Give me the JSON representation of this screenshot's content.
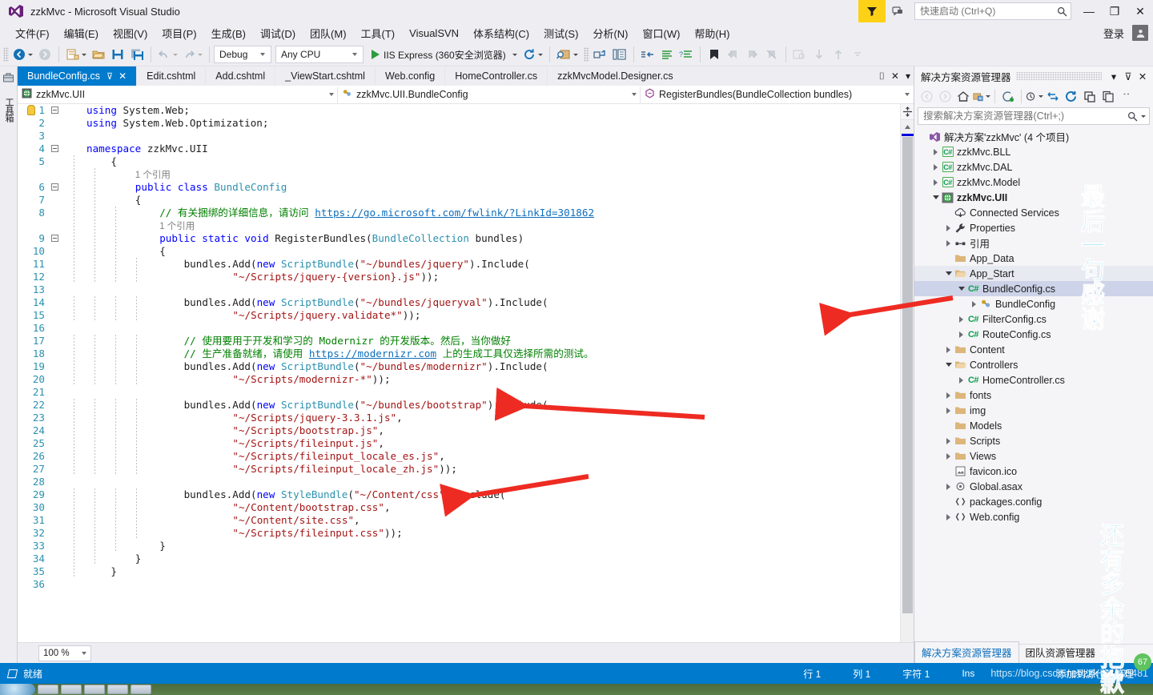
{
  "window": {
    "title": "zzkMvc - Microsoft Visual Studio",
    "minimize": "—",
    "maximize": "❐",
    "close": "✕",
    "signin": "登录",
    "accent": "#007acc"
  },
  "quick_launch": {
    "placeholder": "快速启动 (Ctrl+Q)",
    "value": ""
  },
  "menu": [
    {
      "label": "文件(F)"
    },
    {
      "label": "编辑(E)"
    },
    {
      "label": "视图(V)"
    },
    {
      "label": "项目(P)"
    },
    {
      "label": "生成(B)"
    },
    {
      "label": "调试(D)"
    },
    {
      "label": "团队(M)"
    },
    {
      "label": "工具(T)"
    },
    {
      "label": "VisualSVN"
    },
    {
      "label": "体系结构(C)"
    },
    {
      "label": "测试(S)"
    },
    {
      "label": "分析(N)"
    },
    {
      "label": "窗口(W)"
    },
    {
      "label": "帮助(H)"
    }
  ],
  "toolbar": {
    "configuration": "Debug",
    "platform": "Any CPU",
    "run_target": "IIS Express (360安全浏览器)",
    "icons": [
      "navigate-back-icon",
      "navigate-forward-icon",
      "new-project-icon",
      "open-file-icon",
      "save-icon",
      "save-all-icon",
      "undo-icon",
      "redo-icon",
      "refresh-icon",
      "find-icon",
      "goto-icon",
      "comment-icon",
      "uncomment-icon",
      "indent-icon",
      "outdent-icon",
      "bookmark-icon",
      "prev-bookmark-icon",
      "next-bookmark-icon",
      "clear-bookmarks-icon",
      "preview-icon",
      "step-down-icon",
      "step-up-icon"
    ]
  },
  "left_dock": {
    "toolbox_label": "工具箱"
  },
  "document_tabs": [
    {
      "label": "BundleConfig.cs",
      "active": true,
      "pin": "⊽",
      "close": "✕"
    },
    {
      "label": "Edit.cshtml",
      "active": false
    },
    {
      "label": "Add.cshtml",
      "active": false
    },
    {
      "label": "_ViewStart.cshtml",
      "active": false
    },
    {
      "label": "Web.config",
      "active": false
    },
    {
      "label": "HomeController.cs",
      "active": false
    },
    {
      "label": "zzkMvcModel.Designer.cs",
      "active": false
    }
  ],
  "tabstrip_right": {
    "pin": "⌷",
    "close": "✕",
    "overflow": "▾"
  },
  "navigation_bar": {
    "project": "zzkMvc.UII",
    "type": "zzkMvc.UII.BundleConfig",
    "member": "RegisterBundles(BundleCollection bundles)"
  },
  "code": {
    "total_lines": 36,
    "reference_badge": "1 个引用",
    "lines": [
      {
        "n": 1,
        "segments": [
          {
            "t": "k",
            "v": "using"
          },
          {
            "t": "pl",
            "v": " System.Web;"
          }
        ],
        "indent": 0,
        "fold": "minus",
        "bulb": true
      },
      {
        "n": 2,
        "segments": [
          {
            "t": "k",
            "v": "using"
          },
          {
            "t": "pl",
            "v": " System.Web.Optimization;"
          }
        ],
        "indent": 0
      },
      {
        "n": 3,
        "segments": []
      },
      {
        "n": 4,
        "segments": [
          {
            "t": "k",
            "v": "namespace"
          },
          {
            "t": "pl",
            "v": " zzkMvc.UII"
          }
        ],
        "indent": 0,
        "fold": "minus"
      },
      {
        "n": 5,
        "segments": [
          {
            "t": "pl",
            "v": "{"
          }
        ],
        "indent": 1
      },
      {
        "n": null,
        "segments": [
          {
            "t": "ref",
            "v": "1 个引用"
          }
        ],
        "indent": 2
      },
      {
        "n": 6,
        "segments": [
          {
            "t": "k",
            "v": "public"
          },
          {
            "t": "pl",
            "v": " "
          },
          {
            "t": "k",
            "v": "class"
          },
          {
            "t": "pl",
            "v": " "
          },
          {
            "t": "t",
            "v": "BundleConfig"
          }
        ],
        "indent": 2,
        "fold": "minus"
      },
      {
        "n": 7,
        "segments": [
          {
            "t": "pl",
            "v": "{"
          }
        ],
        "indent": 2
      },
      {
        "n": 8,
        "segments": [
          {
            "t": "c",
            "v": "// 有关捆绑的详细信息，请访问 "
          },
          {
            "t": "lnk",
            "v": "https://go.microsoft.com/fwlink/?LinkId=301862"
          }
        ],
        "indent": 3
      },
      {
        "n": null,
        "segments": [
          {
            "t": "ref",
            "v": "1 个引用"
          }
        ],
        "indent": 3
      },
      {
        "n": 9,
        "segments": [
          {
            "t": "k",
            "v": "public"
          },
          {
            "t": "pl",
            "v": " "
          },
          {
            "t": "k",
            "v": "static"
          },
          {
            "t": "pl",
            "v": " "
          },
          {
            "t": "k",
            "v": "void"
          },
          {
            "t": "pl",
            "v": " RegisterBundles("
          },
          {
            "t": "t",
            "v": "BundleCollection"
          },
          {
            "t": "pl",
            "v": " bundles)"
          }
        ],
        "indent": 3,
        "fold": "minus"
      },
      {
        "n": 10,
        "segments": [
          {
            "t": "pl",
            "v": "{"
          }
        ],
        "indent": 3
      },
      {
        "n": 11,
        "segments": [
          {
            "t": "pl",
            "v": "bundles.Add("
          },
          {
            "t": "k",
            "v": "new"
          },
          {
            "t": "pl",
            "v": " "
          },
          {
            "t": "t",
            "v": "ScriptBundle"
          },
          {
            "t": "pl",
            "v": "("
          },
          {
            "t": "s",
            "v": "\"~/bundles/jquery\""
          },
          {
            "t": "pl",
            "v": ").Include("
          }
        ],
        "indent": 4
      },
      {
        "n": 12,
        "segments": [
          {
            "t": "s",
            "v": "\"~/Scripts/jquery-{version}.js\""
          },
          {
            "t": "pl",
            "v": "));"
          }
        ],
        "indent": 6
      },
      {
        "n": 13,
        "segments": []
      },
      {
        "n": 14,
        "segments": [
          {
            "t": "pl",
            "v": "bundles.Add("
          },
          {
            "t": "k",
            "v": "new"
          },
          {
            "t": "pl",
            "v": " "
          },
          {
            "t": "t",
            "v": "ScriptBundle"
          },
          {
            "t": "pl",
            "v": "("
          },
          {
            "t": "s",
            "v": "\"~/bundles/jqueryval\""
          },
          {
            "t": "pl",
            "v": ").Include("
          }
        ],
        "indent": 4
      },
      {
        "n": 15,
        "segments": [
          {
            "t": "s",
            "v": "\"~/Scripts/jquery.validate*\""
          },
          {
            "t": "pl",
            "v": "));"
          }
        ],
        "indent": 6
      },
      {
        "n": 16,
        "segments": []
      },
      {
        "n": 17,
        "segments": [
          {
            "t": "c",
            "v": "// 使用要用于开发和学习的 Modernizr 的开发版本。然后，当你做好"
          }
        ],
        "indent": 4
      },
      {
        "n": 18,
        "segments": [
          {
            "t": "c",
            "v": "// 生产准备就绪，请使用 "
          },
          {
            "t": "lnk",
            "v": "https://modernizr.com"
          },
          {
            "t": "c",
            "v": " 上的生成工具仅选择所需的测试。"
          }
        ],
        "indent": 4
      },
      {
        "n": 19,
        "segments": [
          {
            "t": "pl",
            "v": "bundles.Add("
          },
          {
            "t": "k",
            "v": "new"
          },
          {
            "t": "pl",
            "v": " "
          },
          {
            "t": "t",
            "v": "ScriptBundle"
          },
          {
            "t": "pl",
            "v": "("
          },
          {
            "t": "s",
            "v": "\"~/bundles/modernizr\""
          },
          {
            "t": "pl",
            "v": ").Include("
          }
        ],
        "indent": 4
      },
      {
        "n": 20,
        "segments": [
          {
            "t": "s",
            "v": "\"~/Scripts/modernizr-*\""
          },
          {
            "t": "pl",
            "v": "));"
          }
        ],
        "indent": 6
      },
      {
        "n": 21,
        "segments": []
      },
      {
        "n": 22,
        "segments": [
          {
            "t": "pl",
            "v": "bundles.Add("
          },
          {
            "t": "k",
            "v": "new"
          },
          {
            "t": "pl",
            "v": " "
          },
          {
            "t": "t",
            "v": "ScriptBundle"
          },
          {
            "t": "pl",
            "v": "("
          },
          {
            "t": "s",
            "v": "\"~/bundles/bootstrap\""
          },
          {
            "t": "pl",
            "v": ").Include("
          }
        ],
        "indent": 4
      },
      {
        "n": 23,
        "segments": [
          {
            "t": "s",
            "v": "\"~/Scripts/jquery-3.3.1.js\""
          },
          {
            "t": "pl",
            "v": ","
          }
        ],
        "indent": 6
      },
      {
        "n": 24,
        "segments": [
          {
            "t": "s",
            "v": "\"~/Scripts/bootstrap.js\""
          },
          {
            "t": "pl",
            "v": ","
          }
        ],
        "indent": 6
      },
      {
        "n": 25,
        "segments": [
          {
            "t": "s",
            "v": "\"~/Scripts/fileinput.js\""
          },
          {
            "t": "pl",
            "v": ","
          }
        ],
        "indent": 6
      },
      {
        "n": 26,
        "segments": [
          {
            "t": "s",
            "v": "\"~/Scripts/fileinput_locale_es.js\""
          },
          {
            "t": "pl",
            "v": ","
          }
        ],
        "indent": 6
      },
      {
        "n": 27,
        "segments": [
          {
            "t": "s",
            "v": "\"~/Scripts/fileinput_locale_zh.js\""
          },
          {
            "t": "pl",
            "v": "));"
          }
        ],
        "indent": 6
      },
      {
        "n": 28,
        "segments": []
      },
      {
        "n": 29,
        "segments": [
          {
            "t": "pl",
            "v": "bundles.Add("
          },
          {
            "t": "k",
            "v": "new"
          },
          {
            "t": "pl",
            "v": " "
          },
          {
            "t": "t",
            "v": "StyleBundle"
          },
          {
            "t": "pl",
            "v": "("
          },
          {
            "t": "s",
            "v": "\"~/Content/css\""
          },
          {
            "t": "pl",
            "v": ").Include("
          }
        ],
        "indent": 4
      },
      {
        "n": 30,
        "segments": [
          {
            "t": "s",
            "v": "\"~/Content/bootstrap.css\""
          },
          {
            "t": "pl",
            "v": ","
          }
        ],
        "indent": 6
      },
      {
        "n": 31,
        "segments": [
          {
            "t": "s",
            "v": "\"~/Content/site.css\""
          },
          {
            "t": "pl",
            "v": ","
          }
        ],
        "indent": 6
      },
      {
        "n": 32,
        "segments": [
          {
            "t": "s",
            "v": "\"~/Scripts/fileinput.css\""
          },
          {
            "t": "pl",
            "v": "));"
          }
        ],
        "indent": 6
      },
      {
        "n": 33,
        "segments": [
          {
            "t": "pl",
            "v": "}"
          }
        ],
        "indent": 3
      },
      {
        "n": 34,
        "segments": [
          {
            "t": "pl",
            "v": "}"
          }
        ],
        "indent": 2
      },
      {
        "n": 35,
        "segments": [
          {
            "t": "pl",
            "v": "}"
          }
        ],
        "indent": 1
      },
      {
        "n": 36,
        "segments": []
      }
    ]
  },
  "editor_footer": {
    "zoom": "100 %"
  },
  "solution_explorer": {
    "title": "解决方案资源管理器",
    "dropdown": "▾",
    "pin": "⊽",
    "close": "✕",
    "search_placeholder": "搜索解决方案资源管理器(Ctrl+;)",
    "search_value": "",
    "toolbar_icons": [
      "back-icon",
      "forward-icon",
      "home-icon",
      "pending-changes-icon",
      "sync-with-active-document-icon",
      "refresh-icon",
      "show-all-files-icon",
      "collapse-all-icon",
      "properties-icon",
      "preview-icon"
    ],
    "tree": [
      {
        "depth": 0,
        "twisty": "none",
        "icon": "solution-icon",
        "label": "解决方案'zzkMvc' (4 个项目)",
        "bold": false
      },
      {
        "depth": 1,
        "twisty": "right",
        "icon": "csharp-icon",
        "label": "zzkMvc.BLL"
      },
      {
        "depth": 1,
        "twisty": "right",
        "icon": "csharp-icon",
        "label": "zzkMvc.DAL"
      },
      {
        "depth": 1,
        "twisty": "right",
        "icon": "csharp-icon",
        "label": "zzkMvc.Model"
      },
      {
        "depth": 1,
        "twisty": "down",
        "icon": "web-project-icon",
        "label": "zzkMvc.UII",
        "bold": true
      },
      {
        "depth": 2,
        "twisty": "none",
        "icon": "connected-services-icon",
        "label": "Connected Services"
      },
      {
        "depth": 2,
        "twisty": "right",
        "icon": "properties-wrench-icon",
        "label": "Properties"
      },
      {
        "depth": 2,
        "twisty": "right",
        "icon": "references-icon",
        "label": "引用"
      },
      {
        "depth": 2,
        "twisty": "none",
        "icon": "folder-icon",
        "label": "App_Data"
      },
      {
        "depth": 2,
        "twisty": "down",
        "icon": "folder-open-icon",
        "label": "App_Start",
        "highlight2": true
      },
      {
        "depth": 3,
        "twisty": "down",
        "icon": "csharp-file-icon",
        "label": "BundleConfig.cs",
        "selected": true
      },
      {
        "depth": 4,
        "twisty": "right",
        "icon": "class-icon",
        "label": "BundleConfig"
      },
      {
        "depth": 3,
        "twisty": "right",
        "icon": "csharp-file-icon",
        "label": "FilterConfig.cs"
      },
      {
        "depth": 3,
        "twisty": "right",
        "icon": "csharp-file-icon",
        "label": "RouteConfig.cs"
      },
      {
        "depth": 2,
        "twisty": "right",
        "icon": "folder-icon",
        "label": "Content"
      },
      {
        "depth": 2,
        "twisty": "down",
        "icon": "folder-open-icon",
        "label": "Controllers"
      },
      {
        "depth": 3,
        "twisty": "right",
        "icon": "csharp-file-icon",
        "label": "HomeController.cs"
      },
      {
        "depth": 2,
        "twisty": "right",
        "icon": "folder-icon",
        "label": "fonts"
      },
      {
        "depth": 2,
        "twisty": "right",
        "icon": "folder-icon",
        "label": "img"
      },
      {
        "depth": 2,
        "twisty": "none",
        "icon": "folder-icon",
        "label": "Models"
      },
      {
        "depth": 2,
        "twisty": "right",
        "icon": "folder-icon",
        "label": "Scripts"
      },
      {
        "depth": 2,
        "twisty": "right",
        "icon": "folder-icon",
        "label": "Views"
      },
      {
        "depth": 2,
        "twisty": "none",
        "icon": "image-file-icon",
        "label": "favicon.ico"
      },
      {
        "depth": 2,
        "twisty": "right",
        "icon": "asax-file-icon",
        "label": "Global.asax"
      },
      {
        "depth": 2,
        "twisty": "none",
        "icon": "config-file-icon",
        "label": "packages.config"
      },
      {
        "depth": 2,
        "twisty": "right",
        "icon": "config-file-icon",
        "label": "Web.config"
      }
    ],
    "bottom_tabs": [
      {
        "label": "解决方案资源管理器",
        "active": true
      },
      {
        "label": "团队资源管理器",
        "active": false
      }
    ]
  },
  "status_bar": {
    "ready": "就绪",
    "line_label": "行 1",
    "col_label": "列 1",
    "char_label": "字符 1",
    "ins_label": "Ins",
    "url": "https://blog.csdn.net/zzk_01_05481",
    "source_control": "添加到源代码管理"
  },
  "watermark": {
    "col1": [
      "最",
      "后",
      "一",
      "句",
      "感",
      "谢"
    ],
    "col2": [
      "还",
      "有",
      "多",
      "余",
      "的",
      "抱",
      "歉"
    ],
    "badge": "67"
  }
}
